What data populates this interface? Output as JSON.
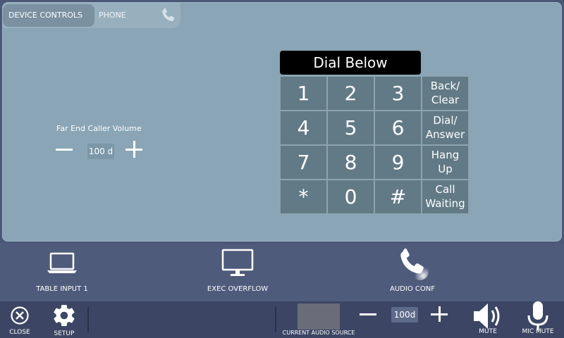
{
  "tabs": {
    "device_controls": "DEVICE CONTROLS",
    "phone": "PHONE",
    "phone_icon": "phone-handset-icon"
  },
  "far_end": {
    "label": "Far End Caller Volume",
    "value": "100 d"
  },
  "dialpad": {
    "title": "Dial Below",
    "keys": [
      {
        "label": "1",
        "type": "num"
      },
      {
        "label": "2",
        "type": "num"
      },
      {
        "label": "3",
        "type": "num"
      },
      {
        "label": "Back/\nClear",
        "type": "fn"
      },
      {
        "label": "4",
        "type": "num"
      },
      {
        "label": "5",
        "type": "num"
      },
      {
        "label": "6",
        "type": "num"
      },
      {
        "label": "Dial/\nAnswer",
        "type": "fn"
      },
      {
        "label": "7",
        "type": "num"
      },
      {
        "label": "8",
        "type": "num"
      },
      {
        "label": "9",
        "type": "num"
      },
      {
        "label": "Hang\nUp",
        "type": "fn"
      },
      {
        "label": "*",
        "type": "num"
      },
      {
        "label": "0",
        "type": "num"
      },
      {
        "label": "#",
        "type": "num"
      },
      {
        "label": "Call\nWaiting",
        "type": "fn"
      }
    ]
  },
  "sources": [
    {
      "label": "TABLE INPUT 1",
      "icon": "laptop-icon"
    },
    {
      "label": "EXEC OVERFLOW",
      "icon": "monitor-icon"
    },
    {
      "label": "AUDIO CONF",
      "icon": "phone-handset-icon"
    }
  ],
  "bottom": {
    "close": "CLOSE",
    "setup": "SETUP",
    "current_source": "CURRENT AUDIO SOURCE",
    "volume": "100d",
    "mute": "MUTE",
    "mic_mute": "MIC MUTE"
  },
  "colors": {
    "panel": "#8aa5b5",
    "key": "#627a86",
    "bar": "#4f5b7b",
    "bottom_bar": "#3c4664"
  }
}
